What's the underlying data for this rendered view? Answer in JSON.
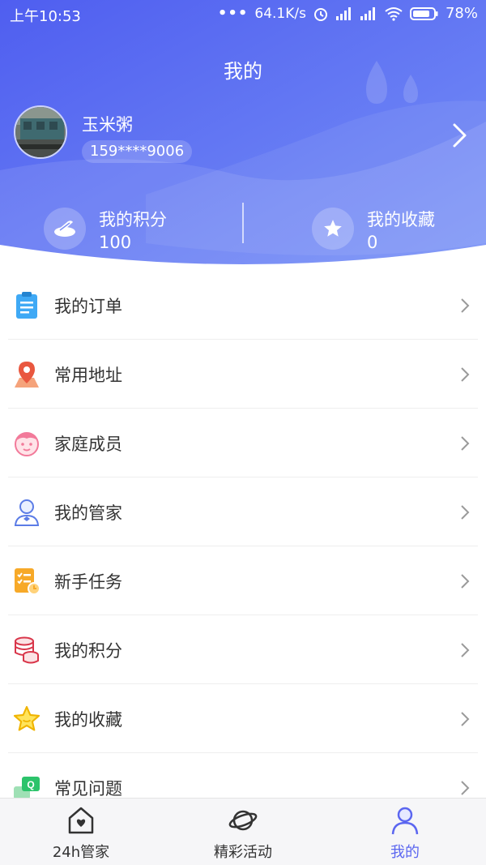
{
  "status_bar": {
    "time": "上午10:53",
    "dots": "•••",
    "network_speed": "64.1K/s",
    "battery": "78%"
  },
  "header": {
    "title": "我的",
    "username": "玉米粥",
    "phone": "159****9006",
    "stats": [
      {
        "label": "我的积分",
        "value": "100",
        "icon": "coins-icon"
      },
      {
        "label": "我的收藏",
        "value": "0",
        "icon": "star-icon"
      }
    ]
  },
  "menu": [
    {
      "label": "我的订单",
      "icon": "order-clipboard-icon"
    },
    {
      "label": "常用地址",
      "icon": "location-pin-icon"
    },
    {
      "label": "家庭成员",
      "icon": "family-baby-icon"
    },
    {
      "label": "我的管家",
      "icon": "butler-icon"
    },
    {
      "label": "新手任务",
      "icon": "task-list-icon"
    },
    {
      "label": "我的积分",
      "icon": "points-coins-icon"
    },
    {
      "label": "我的收藏",
      "icon": "favorite-star-icon"
    },
    {
      "label": "常见问题",
      "icon": "faq-chat-icon"
    }
  ],
  "tabbar": [
    {
      "label": "24h管家",
      "icon": "home-heart-icon",
      "active": false
    },
    {
      "label": "精彩活动",
      "icon": "planet-icon",
      "active": false
    },
    {
      "label": "我的",
      "icon": "user-icon",
      "active": true
    }
  ],
  "colors": {
    "header_gradient_start": "#4f62f0",
    "header_gradient_end": "#7b8ff5",
    "tab_active": "#5b66f0"
  }
}
